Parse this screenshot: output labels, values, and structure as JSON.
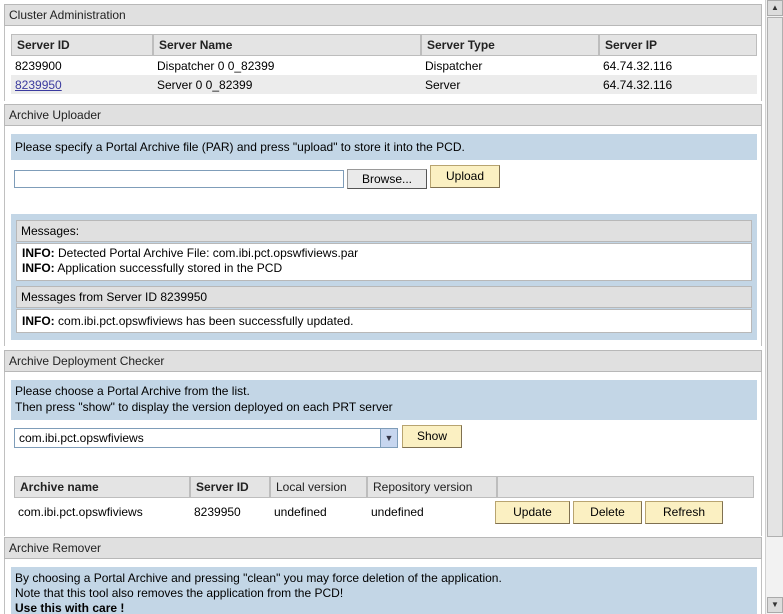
{
  "cluster": {
    "title": "Cluster Administration",
    "columns": [
      "Server ID",
      "Server Name",
      "Server Type",
      "Server IP"
    ],
    "rows": [
      {
        "id": "8239900",
        "name": "Dispatcher 0 0_82399",
        "type": "Dispatcher",
        "ip": "64.74.32.116"
      },
      {
        "id": "8239950",
        "name": "Server 0 0_82399",
        "type": "Server",
        "ip": "64.74.32.116"
      }
    ]
  },
  "uploader": {
    "title": "Archive Uploader",
    "instruction": "Please specify a Portal Archive file (PAR) and press \"upload\" to store it into the PCD.",
    "file_value": "",
    "browse_label": "Browse...",
    "upload_label": "Upload",
    "messages_title": "Messages:",
    "messages": [
      {
        "level": "INFO:",
        "text": "Detected Portal Archive File: com.ibi.pct.opswfiviews.par"
      },
      {
        "level": "INFO:",
        "text": "Application successfully stored in the PCD"
      }
    ],
    "server_messages_title": "Messages from Server ID 8239950",
    "server_messages": [
      {
        "level": "INFO:",
        "text": "com.ibi.pct.opswfiviews has been successfully updated."
      }
    ]
  },
  "checker": {
    "title": "Archive Deployment Checker",
    "instruction_line1": "Please choose a Portal Archive from the list.",
    "instruction_line2": "Then press \"show\" to display the version deployed on each PRT server",
    "selected_archive": "com.ibi.pct.opswfiviews",
    "show_label": "Show",
    "columns": [
      "Archive name",
      "Server ID",
      "Local version",
      "Repository version"
    ],
    "row": {
      "archive": "com.ibi.pct.opswfiviews",
      "server_id": "8239950",
      "local": "undefined",
      "repo": "undefined"
    },
    "update_label": "Update",
    "delete_label": "Delete",
    "refresh_label": "Refresh"
  },
  "remover": {
    "title": "Archive Remover",
    "line1": "By choosing a Portal Archive and pressing \"clean\" you may force deletion of the application.",
    "line2": "Note that this tool also removes the application from the PCD!",
    "line3": "Use this with care !"
  },
  "colors": {
    "panel_blue": "#c3d6e6",
    "header_grey": "#e0e0e0",
    "button_yellow": "#fbf0c2"
  }
}
